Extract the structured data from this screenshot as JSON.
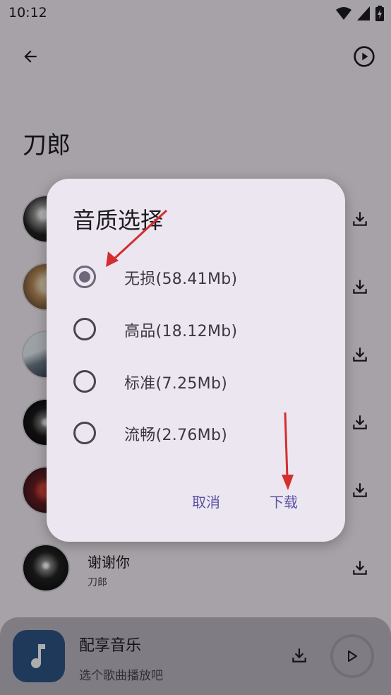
{
  "status_bar": {
    "time": "10:12"
  },
  "header": {
    "title": "刀郎"
  },
  "songs": [
    {
      "title": "",
      "artist": ""
    },
    {
      "title": "",
      "artist": ""
    },
    {
      "title": "",
      "artist": ""
    },
    {
      "title": "",
      "artist": ""
    },
    {
      "title": "",
      "artist": ""
    },
    {
      "title": "谢谢你",
      "artist": "刀郎"
    }
  ],
  "player": {
    "title": "配享音乐",
    "subtitle": "选个歌曲播放吧"
  },
  "dialog": {
    "title": "音质选择",
    "options": [
      {
        "label": "无损(58.41Mb)",
        "selected": true
      },
      {
        "label": "高品(18.12Mb)",
        "selected": false
      },
      {
        "label": "标准(7.25Mb)",
        "selected": false
      },
      {
        "label": "流畅(2.76Mb)",
        "selected": false
      }
    ],
    "cancel_label": "取消",
    "confirm_label": "下载"
  },
  "colors": {
    "accent": "#5d52a3",
    "annotation": "#d32f2f",
    "player_art": "#2f5586"
  },
  "icons": [
    "back-arrow-icon",
    "play-circle-icon",
    "download-icon",
    "music-note-icon",
    "play-icon",
    "wifi-icon",
    "signal-icon",
    "battery-icon"
  ]
}
